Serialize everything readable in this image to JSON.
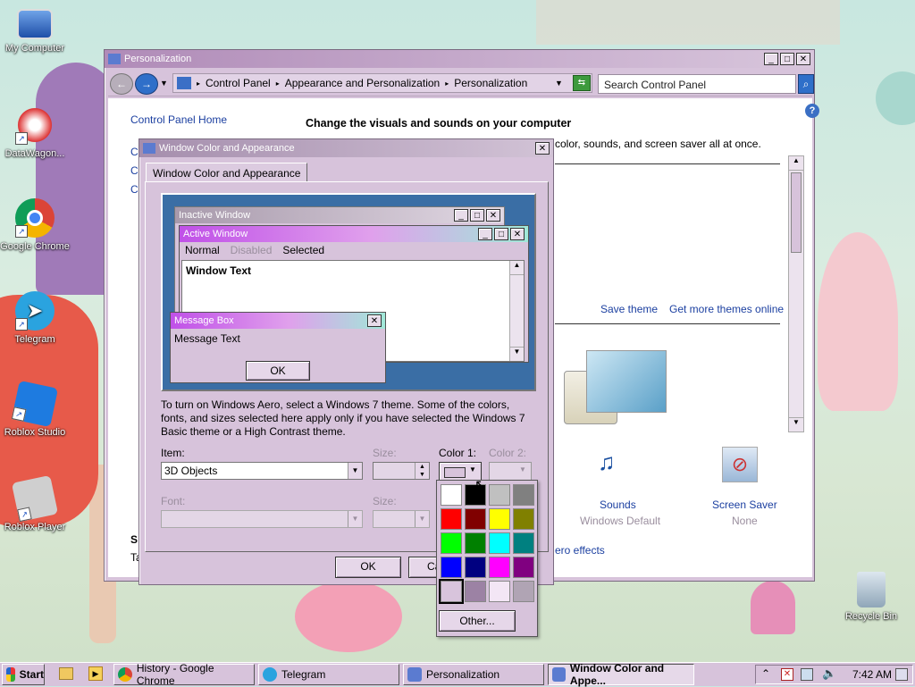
{
  "desktop": {
    "icons": [
      {
        "label": "My Computer",
        "icon": "monitor-icon"
      },
      {
        "label": "DataWagon...",
        "icon": "datawagon-icon"
      },
      {
        "label": "Google Chrome",
        "icon": "chrome-icon"
      },
      {
        "label": "Telegram",
        "icon": "telegram-icon"
      },
      {
        "label": "Roblox Studio",
        "icon": "roblox-studio-icon"
      },
      {
        "label": "Roblox Player",
        "icon": "roblox-player-icon"
      },
      {
        "label": "Recycle Bin",
        "icon": "recycle-bin-icon"
      }
    ]
  },
  "personalization": {
    "title": "Personalization",
    "breadcrumb": [
      "Control Panel",
      "Appearance and Personalization",
      "Personalization"
    ],
    "search_placeholder": "Search Control Panel",
    "sidebar_home": "Control Panel Home",
    "sidebar_partial": [
      "Cl",
      "Cl",
      "Cl"
    ],
    "heading": "Change the visuals and sounds on your computer",
    "subheading_partial": "color, sounds, and screen saver all at once.",
    "save_theme": "Save theme",
    "get_more": "Get more themes online",
    "sounds_label": "Sounds",
    "sounds_value": "Windows Default",
    "screensaver_label": "Screen Saver",
    "screensaver_value": "None",
    "bottom_partial_s": "S",
    "bottom_partial_t": "Ta",
    "aero_partial": "ero effects"
  },
  "dialog": {
    "title": "Window Color and Appearance",
    "tab": "Window Color and Appearance",
    "preview": {
      "inactive": "Inactive Window",
      "active": "Active Window",
      "menu": [
        "Normal",
        "Disabled",
        "Selected"
      ],
      "window_text": "Window Text",
      "msgbox_title": "Message Box",
      "msgbox_text": "Message Text",
      "ok": "OK"
    },
    "info": "To turn on Windows Aero, select a Windows 7 theme.  Some of the colors, fonts, and sizes selected here apply only if you have selected the Windows 7 Basic theme or a High Contrast theme.",
    "item_label": "Item:",
    "item_value": "3D Objects",
    "size_label": "Size:",
    "color1_label": "Color 1:",
    "color2_label": "Color 2:",
    "font_label": "Font:",
    "size2_label": "Size:",
    "ok": "OK",
    "cancel_partial": "Ca"
  },
  "palette": {
    "colors": [
      "#ffffff",
      "#000000",
      "#c0c0c0",
      "#808080",
      "#ff0000",
      "#800000",
      "#ffff00",
      "#808000",
      "#00ff00",
      "#008000",
      "#00ffff",
      "#008080",
      "#0000ff",
      "#000080",
      "#ff00ff",
      "#800080",
      "#d8c4dc",
      "#9c82a4",
      "#f3e6f5",
      "#b0a4b4"
    ],
    "other": "Other..."
  },
  "taskbar": {
    "start": "Start",
    "items": [
      "History - Google Chrome",
      "Telegram",
      "Personalization",
      "Window Color and Appe..."
    ],
    "time": "7:42 AM"
  }
}
